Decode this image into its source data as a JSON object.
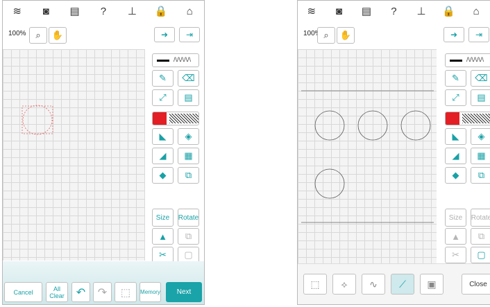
{
  "left_screen": {
    "zoom": "100%",
    "buttons": {
      "size": "Size",
      "rotate": "Rotate",
      "cancel": "Cancel",
      "all_clear_line1": "All",
      "all_clear_line2": "Clear",
      "memory": "Memory",
      "next": "Next"
    }
  },
  "right_screen": {
    "zoom": "100%",
    "buttons": {
      "size": "Size",
      "rotate": "Rotate",
      "close": "Close"
    }
  },
  "colors": {
    "accent": "#1aa3a8",
    "swatch_red": "#e31e24"
  }
}
